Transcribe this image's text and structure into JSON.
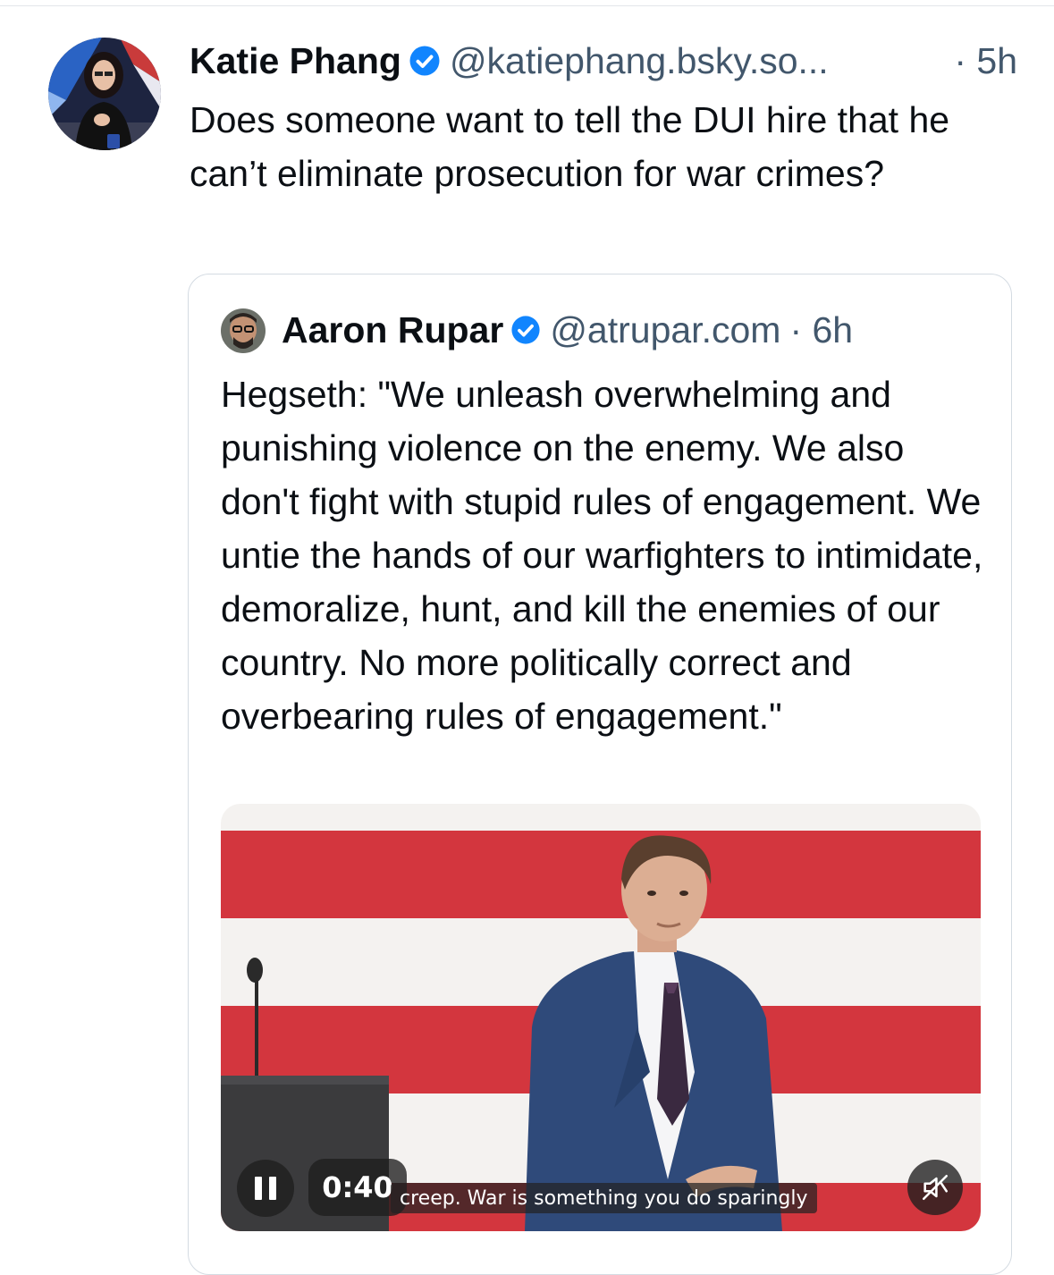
{
  "post": {
    "author_name": "Katie Phang",
    "handle": "@katiephang.bsky.so...",
    "time": "· 5h",
    "text": "Does someone want to tell the DUI hire that he can’t eliminate prosecution for war crimes?"
  },
  "quote": {
    "author_name": "Aaron Rupar",
    "handle": "@atrupar.com",
    "time": "· 6h",
    "text": "Hegseth: \"We unleash overwhelming and punishing violence on the enemy. We also don't fight with stupid rules of engagement. We untie the hands of our warfighters to intimidate, demoralize, hunt, and kill the enemies of our country. No more politically correct and overbearing rules of engagement.\""
  },
  "video": {
    "time_display": "0:40",
    "caption": "creep. War is something you do sparingly",
    "state": "playing",
    "muted": true
  },
  "colors": {
    "verified": "#1185fe",
    "handle": "#42576c",
    "stripe_red": "#d3363e",
    "card_border": "#d4dbe2"
  },
  "icons": [
    "verified-badge-icon",
    "pause-icon",
    "mute-icon"
  ]
}
